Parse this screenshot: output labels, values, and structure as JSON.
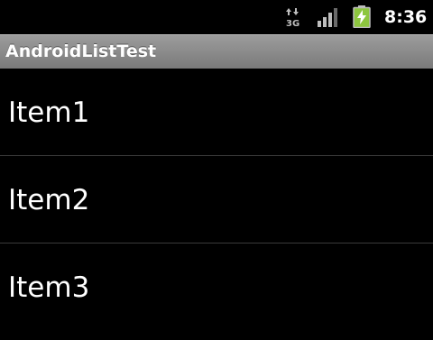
{
  "status_bar": {
    "network_type": "3G",
    "time": "8:36",
    "icons": [
      "data-transfer-icon",
      "signal-strength-icon",
      "battery-charging-icon"
    ],
    "battery_color": "#8dc63f"
  },
  "action_bar": {
    "title": "AndroidListTest"
  },
  "list": {
    "items": [
      {
        "label": "Item1"
      },
      {
        "label": "Item2"
      },
      {
        "label": "Item3"
      }
    ]
  }
}
